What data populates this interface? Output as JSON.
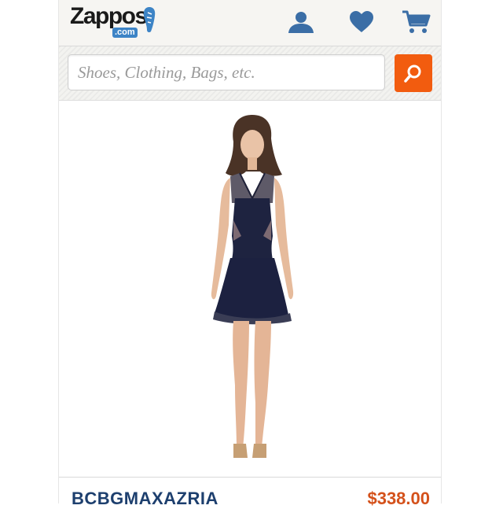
{
  "header": {
    "logo_text": "Zappos",
    "logo_dotcom": ".com",
    "icons": [
      "account-icon",
      "favorites-heart-icon",
      "cart-icon"
    ],
    "accent_color": "#3d84c6"
  },
  "search": {
    "placeholder": "Shoes, Clothing, Bags, etc.",
    "button_color": "#f25c0f"
  },
  "product": {
    "brand": "BCBGMAXAZRIA",
    "price": "$338.00",
    "brand_color": "#1d3f6e",
    "price_color": "#d4511b"
  }
}
